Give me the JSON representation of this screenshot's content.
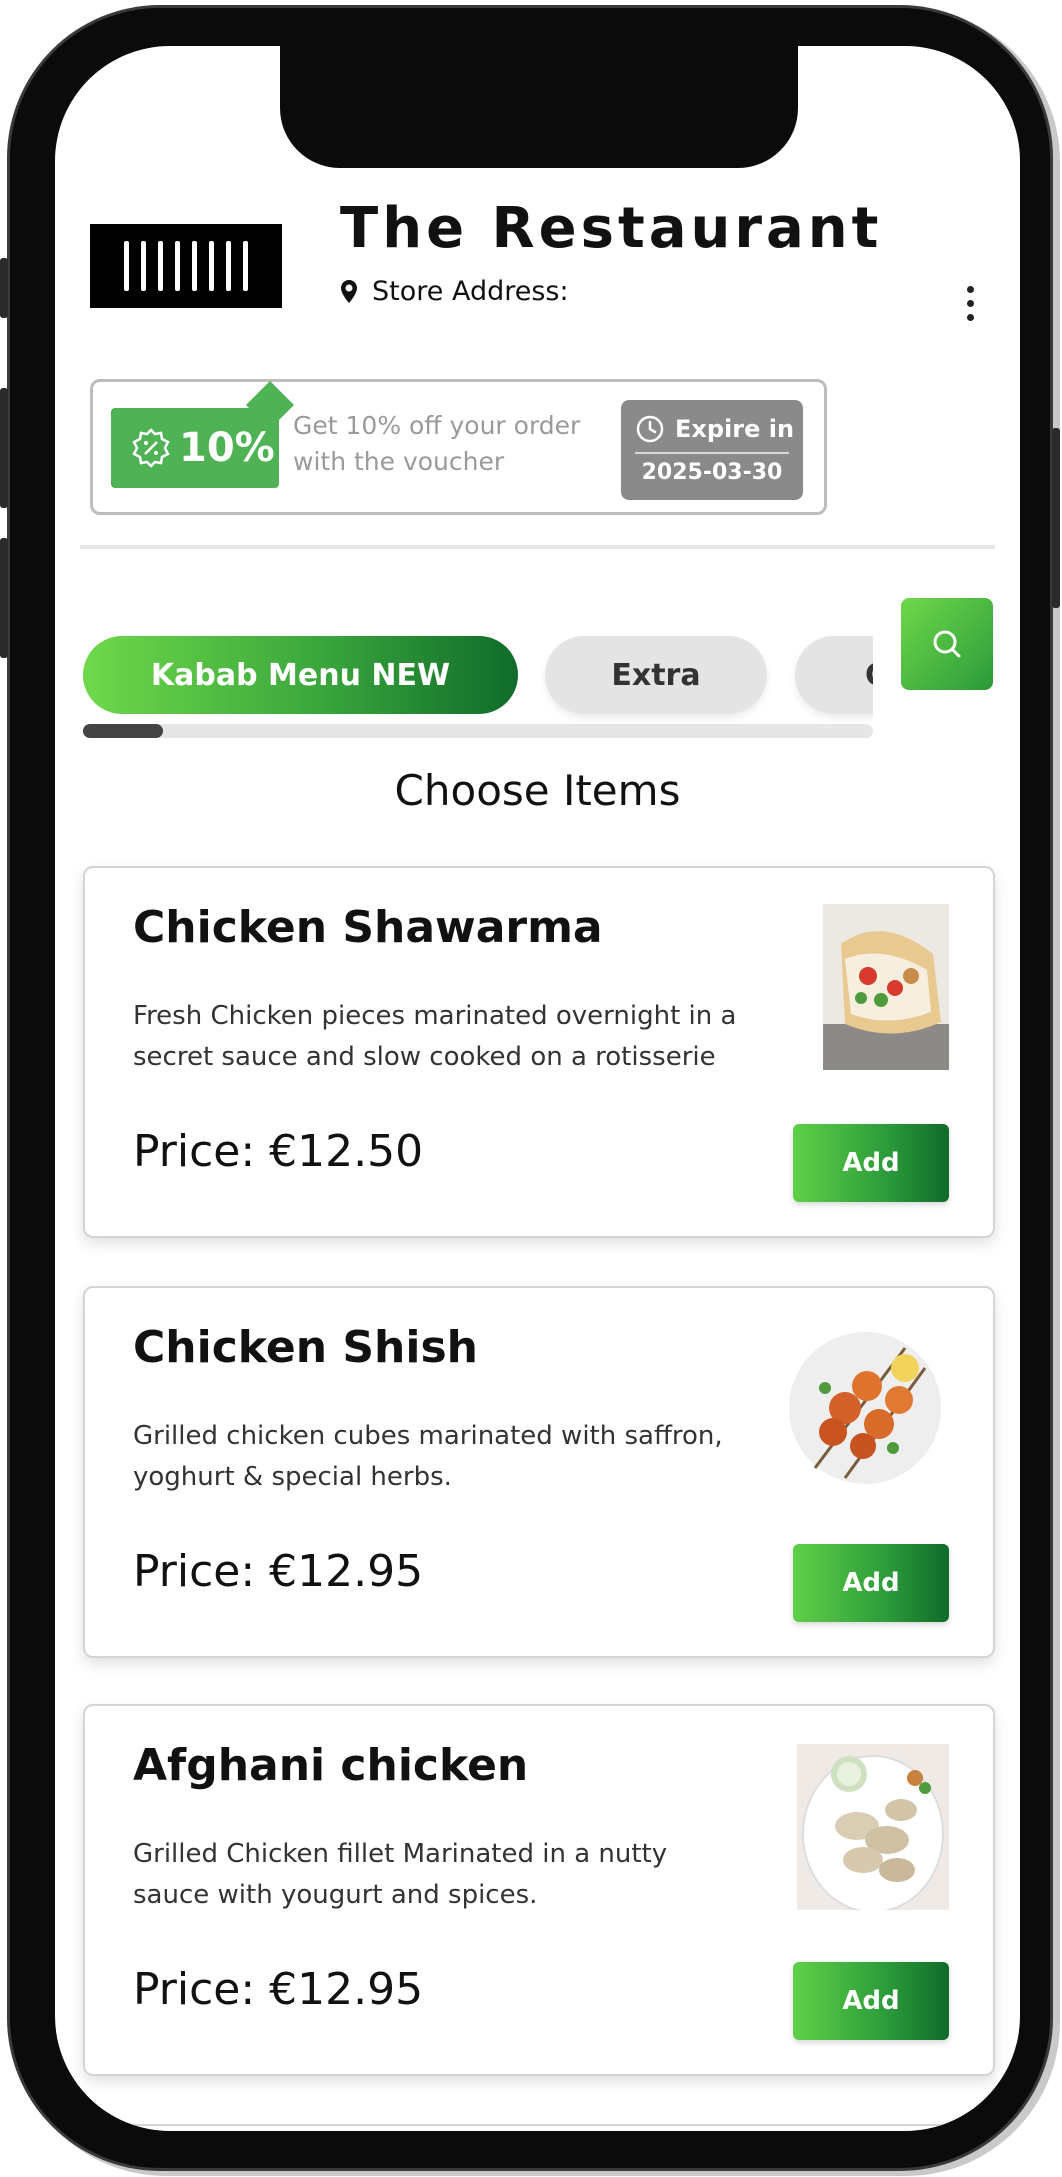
{
  "header": {
    "restaurant_name": "The Restaurant",
    "address_label": "Store Address:"
  },
  "voucher": {
    "discount": "10%",
    "line1": "Get 10% off your order",
    "line2": "with the voucher",
    "expire_label": "Expire in",
    "expire_date": "2025-03-30"
  },
  "tabs": [
    {
      "label": "Kabab Menu NEW",
      "active": true
    },
    {
      "label": "Extra",
      "active": false
    },
    {
      "label": "C",
      "active": false
    }
  ],
  "section_title": "Choose Items",
  "items": [
    {
      "name": "Chicken Shawarma",
      "desc_line1": "Fresh Chicken pieces marinated overnight in a",
      "desc_line2": "secret sauce and slow cooked on a rotisserie",
      "price": "Price: €12.50",
      "add_label": "Add"
    },
    {
      "name": "Chicken Shish",
      "desc_line1": "Grilled chicken cubes marinated with saffron,",
      "desc_line2": "yoghurt & special herbs.",
      "price": "Price: €12.95",
      "add_label": "Add"
    },
    {
      "name": "Afghani chicken",
      "desc_line1": "Grilled Chicken fillet Marinated in a nutty",
      "desc_line2": "sauce with yougurt and spices.",
      "price": "Price: €12.95",
      "add_label": "Add"
    }
  ],
  "colors": {
    "brand_green": "#4fb356",
    "gradient_dark": "#0f6b2a",
    "gradient_light": "#6fd84a"
  }
}
